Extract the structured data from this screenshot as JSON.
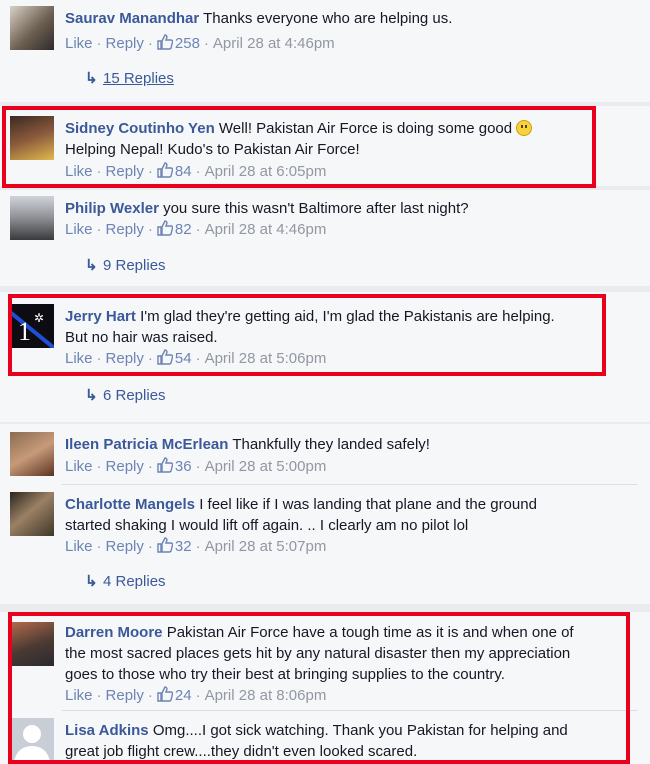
{
  "actions": {
    "like": "Like",
    "reply": "Reply"
  },
  "comments": [
    {
      "name": "Saurav Manandhar",
      "text": "Thanks everyone who are helping us.",
      "likes": "258",
      "time": "April 28 at 4:46pm",
      "replies": "15 Replies"
    },
    {
      "name": "Sidney Coutinho Yen",
      "text": "Well! Pakistan Air Force is doing some good",
      "text2": "Helping Nepal! Kudo's to Pakistan Air Force!",
      "likes": "84",
      "time": "April 28 at 6:05pm"
    },
    {
      "name": "Philip Wexler",
      "text": "you sure this wasn't Baltimore after last night?",
      "likes": "82",
      "time": "April 28 at 4:46pm",
      "replies": "9 Replies"
    },
    {
      "name": "Jerry Hart",
      "text": "I'm glad they're getting aid, I'm glad the Pakistanis are helping.",
      "text2": "But no hair was raised.",
      "likes": "54",
      "time": "April 28 at 5:06pm",
      "replies": "6 Replies"
    },
    {
      "name": "Ileen Patricia McErlean",
      "text": "Thankfully they landed safely!",
      "likes": "36",
      "time": "April 28 at 5:00pm"
    },
    {
      "name": "Charlotte Mangels",
      "text": "I feel like if I was landing that plane and the ground",
      "text2": "started shaking I would lift off again. .. I clearly am no pilot lol",
      "likes": "32",
      "time": "April 28 at 5:07pm",
      "replies": "4 Replies"
    },
    {
      "name": "Darren Moore",
      "text": "Pakistan Air Force have a tough time as it is and when one of",
      "text2": "the most sacred places gets hit by any natural disaster then my appreciation",
      "text3": "goes to those who try their best at bringing supplies to the country.",
      "likes": "24",
      "time": "April 28 at 8:06pm"
    },
    {
      "name": "Lisa Adkins",
      "text": "Omg....I got sick watching. Thank you Pakistan for helping and",
      "text2": "great job flight crew....they didn't even looked scared."
    }
  ],
  "colors": {
    "highlight": "#e8001c",
    "link": "#3b5998",
    "meta": "#9197a3"
  }
}
